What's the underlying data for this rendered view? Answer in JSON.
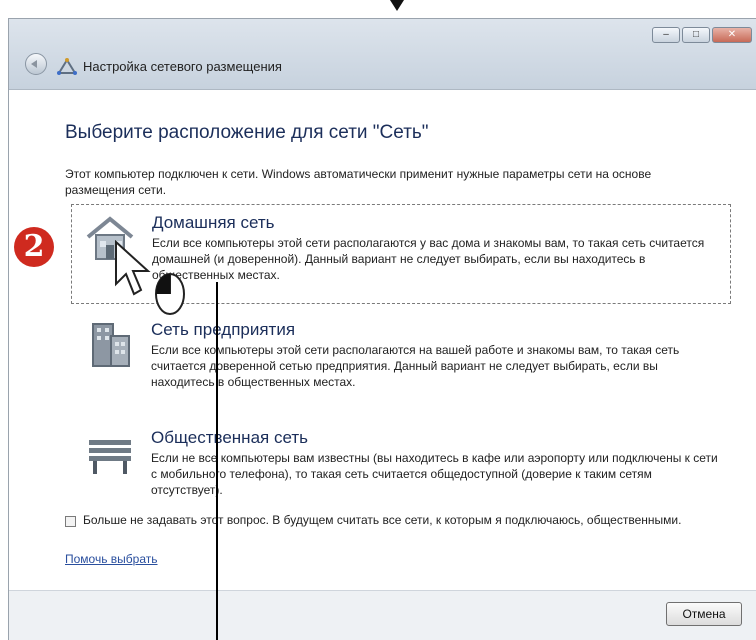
{
  "window": {
    "title": "Настройка сетевого размещения",
    "controls": {
      "minimize": "–",
      "maximize": "□",
      "close": "✕"
    }
  },
  "main": {
    "heading": "Выберите расположение для сети \"Сеть\"",
    "intro": "Этот компьютер подключен к сети. Windows автоматически применит нужные параметры сети на основе размещения сети."
  },
  "options": [
    {
      "title": "Домашняя сеть",
      "description": "Если все компьютеры этой сети располагаются у вас дома и знакомы вам, то такая сеть считается домашней (и доверенной). Данный вариант не следует выбирать, если вы находитесь в общественных местах.",
      "icon": "house-icon"
    },
    {
      "title": "Сеть предприятия",
      "description": "Если все компьютеры этой сети располагаются на вашей работе и знакомы вам, то такая сеть считается доверенной сетью предприятия. Данный вариант не следует выбирать, если вы находитесь в общественных местах.",
      "icon": "office-building-icon"
    },
    {
      "title": "Общественная сеть",
      "description": "Если не все компьютеры вам известны (вы находитесь в кафе или аэропорту или подключены к сети с мобильного телефона), то такая сеть считается общедоступной (доверие к таким сетям отсутствует).",
      "icon": "park-bench-icon"
    }
  ],
  "checkbox": {
    "label": "Больше не задавать этот вопрос. В будущем считать все сети, к которым я подключаюсь, общественными.",
    "checked": false
  },
  "help_link": "Помочь выбрать",
  "footer": {
    "cancel_label": "Отмена"
  },
  "callout": {
    "number": "2"
  }
}
